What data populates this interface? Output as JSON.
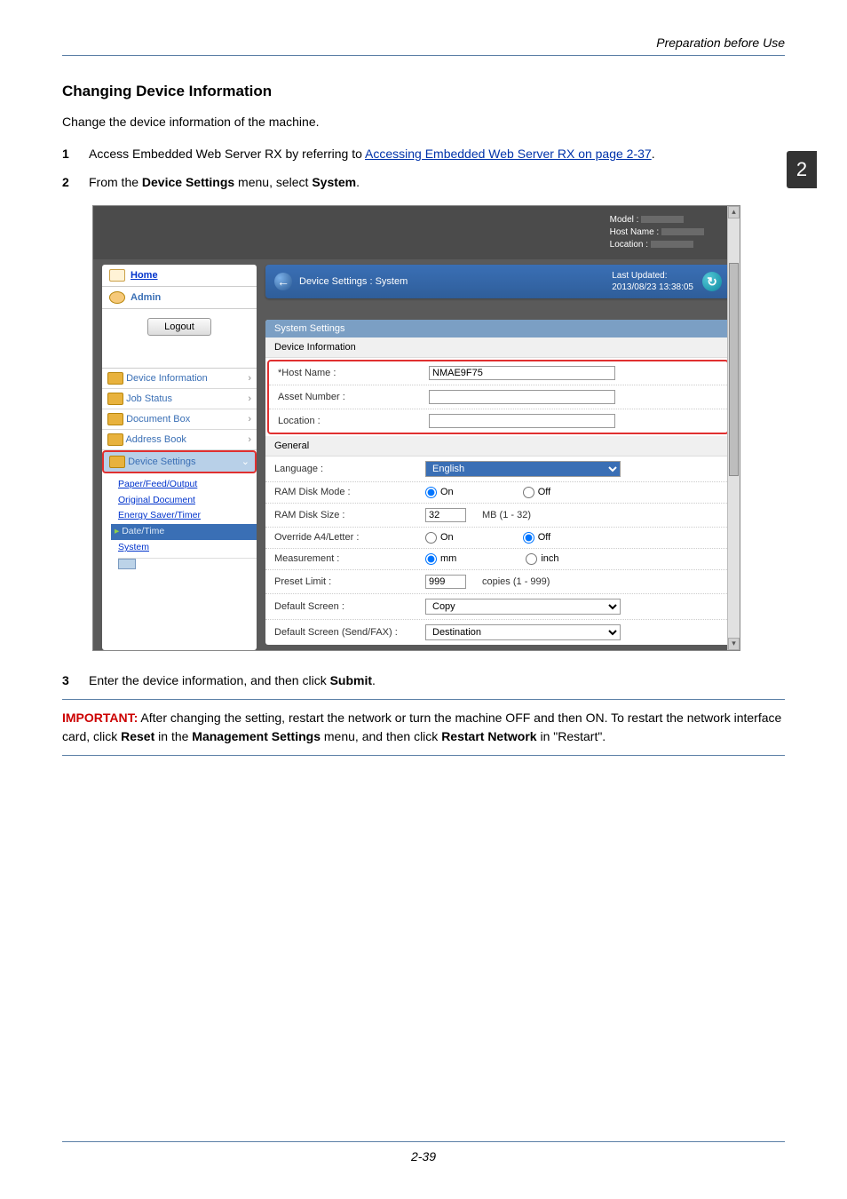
{
  "page": {
    "header_right": "Preparation before Use",
    "badge_number": "2",
    "footer": "2-39"
  },
  "section": {
    "title": "Changing Device Information",
    "intro": "Change the device information of the machine."
  },
  "steps": {
    "s1_num": "1",
    "s1_a": "Access Embedded Web Server RX by referring to ",
    "s1_link": "Accessing Embedded Web Server RX on page 2-37",
    "s1_b": ".",
    "s2_num": "2",
    "s2_a": "From the ",
    "s2_bold1": "Device Settings",
    "s2_b": " menu, select ",
    "s2_bold2": "System",
    "s2_c": ".",
    "s3_num": "3",
    "s3_a": "Enter the device information, and then click ",
    "s3_bold": "Submit",
    "s3_b": "."
  },
  "note": {
    "important_label": "IMPORTANT:",
    "text_a": " After changing the setting, restart the network or turn the machine OFF and then ON. To restart the network interface card, click ",
    "bold1": "Reset",
    "text_b": " in the ",
    "bold2": "Management Settings",
    "text_c": " menu, and then click ",
    "bold3": "Restart Network",
    "text_d": " in \"Restart\"."
  },
  "ss": {
    "header": {
      "model": "Model :",
      "hostname": "Host Name :",
      "location": "Location :"
    },
    "sidebar": {
      "home": "Home",
      "admin": "Admin",
      "logout": "Logout",
      "nav": {
        "device_info": "Device Information",
        "job_status": "Job Status",
        "document_box": "Document Box",
        "address_book": "Address Book",
        "device_settings": "Device Settings"
      },
      "sub": {
        "paper": "Paper/Feed/Output",
        "original": "Original Document",
        "energy": "Energy Saver/Timer",
        "datetime": "Date/Time",
        "system": "System"
      }
    },
    "breadcrumb": {
      "path": "Device Settings : System",
      "last_updated_label": "Last Updated:",
      "last_updated_value": "2013/08/23 13:38:05"
    },
    "panel": {
      "head": "System Settings",
      "sub1": "Device Information",
      "hostname_label": "*Host Name :",
      "hostname_value": "NMAE9F75",
      "asset_label": "Asset Number :",
      "asset_value": "",
      "location_label": "Location :",
      "location_value": "",
      "sub2": "General",
      "language_label": "Language :",
      "language_value": "English",
      "ramdisk_mode_label": "RAM Disk Mode :",
      "on": "On",
      "off": "Off",
      "ramdisk_size_label": "RAM Disk Size :",
      "ramdisk_size_value": "32",
      "ramdisk_size_unit": "MB (1 - 32)",
      "override_label": "Override A4/Letter :",
      "measurement_label": "Measurement :",
      "mm": "mm",
      "inch": "inch",
      "preset_label": "Preset Limit :",
      "preset_value": "999",
      "preset_unit": "copies (1 - 999)",
      "defscreen_label": "Default Screen :",
      "defscreen_value": "Copy",
      "defscreen_fax_label": "Default Screen (Send/FAX) :",
      "defscreen_fax_value": "Destination"
    }
  }
}
